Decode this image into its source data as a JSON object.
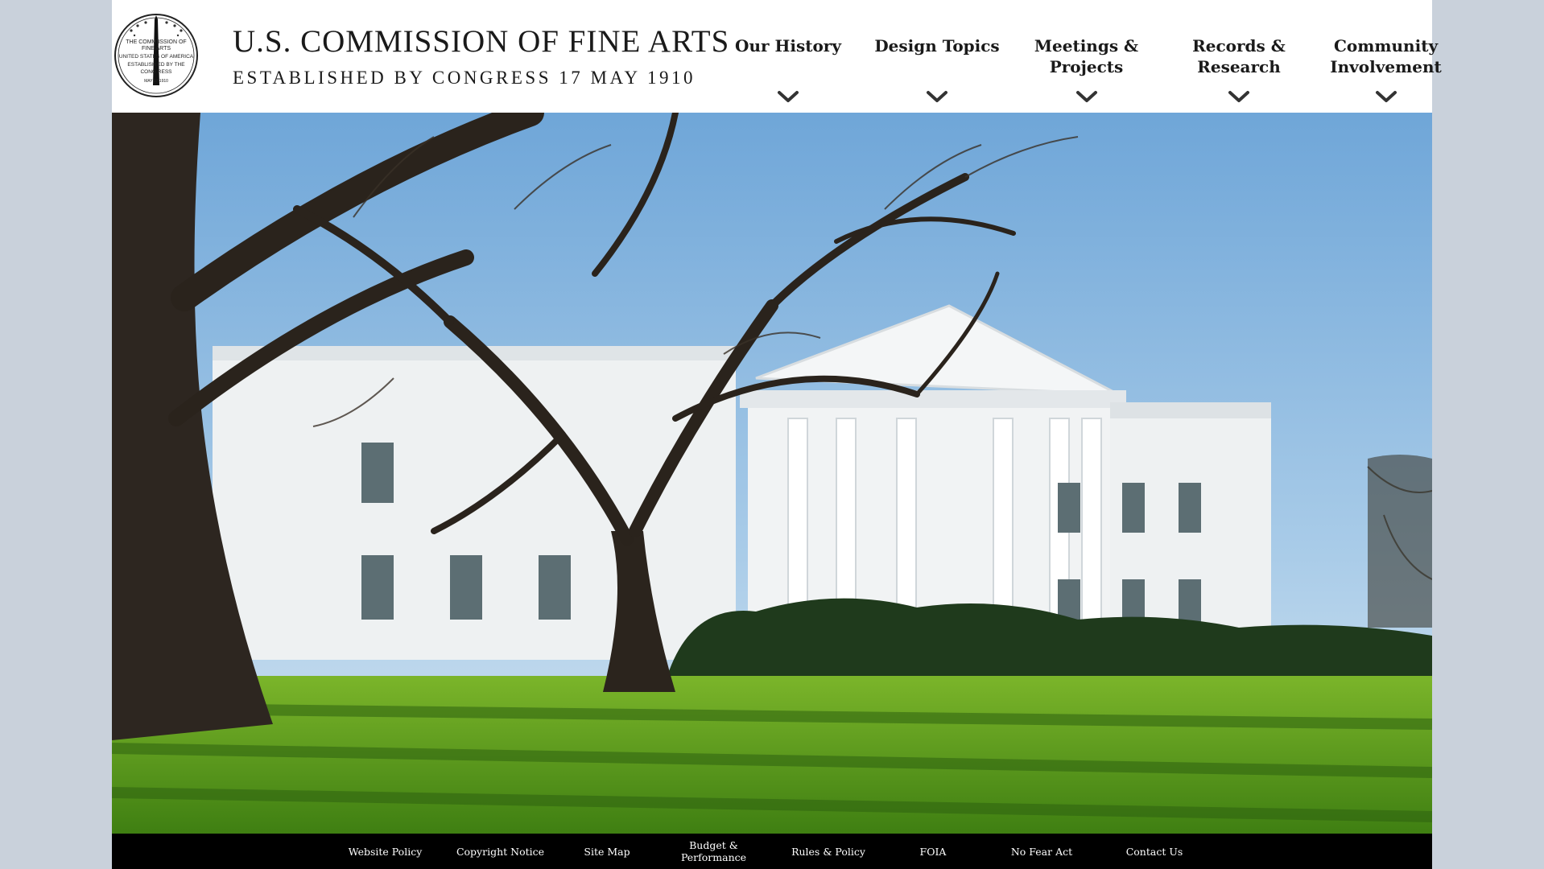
{
  "header": {
    "title": "U.S. COMMISSION OF FINE ARTS",
    "subtitle": "ESTABLISHED BY CONGRESS 17 MAY 1910",
    "seal": {
      "text_top": "THE COMMISSION OF FINE ARTS",
      "text_mid": "UNITED STATES OF AMERICA",
      "text_low": "ESTABLISHED BY THE CONGRESS",
      "text_date": "MAY 17 1910"
    }
  },
  "nav": {
    "items": [
      {
        "label": "Our History",
        "icon": "chevron-down-icon"
      },
      {
        "label": "Design Topics",
        "icon": "chevron-down-icon"
      },
      {
        "label": "Meetings &\nProjects",
        "icon": "chevron-down-icon"
      },
      {
        "label": "Records &\nResearch",
        "icon": "chevron-down-icon"
      },
      {
        "label": "Community\nInvolvement",
        "icon": "chevron-down-icon"
      }
    ]
  },
  "hero": {
    "colors": {
      "sky": "#8db8de",
      "lawn": "#5a9a1e",
      "building": "#f2f4f5"
    }
  },
  "footer": {
    "links": [
      {
        "label": "Website Policy"
      },
      {
        "label": "Copyright Notice"
      },
      {
        "label": "Site Map"
      },
      {
        "label": "Budget &\nPerformance"
      },
      {
        "label": "Rules & Policy"
      },
      {
        "label": "FOIA"
      },
      {
        "label": "No Fear Act"
      },
      {
        "label": "Contact Us"
      }
    ]
  }
}
